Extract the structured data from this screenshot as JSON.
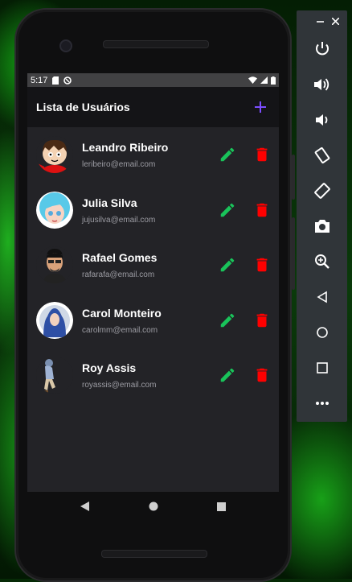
{
  "status_bar": {
    "time": "5:17"
  },
  "app": {
    "title": "Lista de Usuários",
    "add_icon": "plus-icon",
    "accent": "#7c4dff"
  },
  "users": [
    {
      "name": "Leandro Ribeiro",
      "email": "leribeiro@email.com"
    },
    {
      "name": "Julia Silva",
      "email": "jujusilva@email.com"
    },
    {
      "name": "Rafael Gomes",
      "email": "rafarafa@email.com"
    },
    {
      "name": "Carol Monteiro",
      "email": "carolmm@email.com"
    },
    {
      "name": "Roy Assis",
      "email": "royassis@email.com"
    }
  ],
  "colors": {
    "edit": "#19c35a",
    "delete": "#ff0000",
    "list_bg": "#232327",
    "screen_bg": "#141417"
  },
  "emulator_toolbar": {
    "window_controls": [
      "minimize-icon",
      "close-icon"
    ],
    "tools": [
      "power-icon",
      "volume-up-icon",
      "volume-down-icon",
      "rotate-left-icon",
      "rotate-right-icon",
      "camera-icon",
      "zoom-icon",
      "back-icon",
      "home-icon",
      "overview-icon",
      "more-icon"
    ]
  }
}
